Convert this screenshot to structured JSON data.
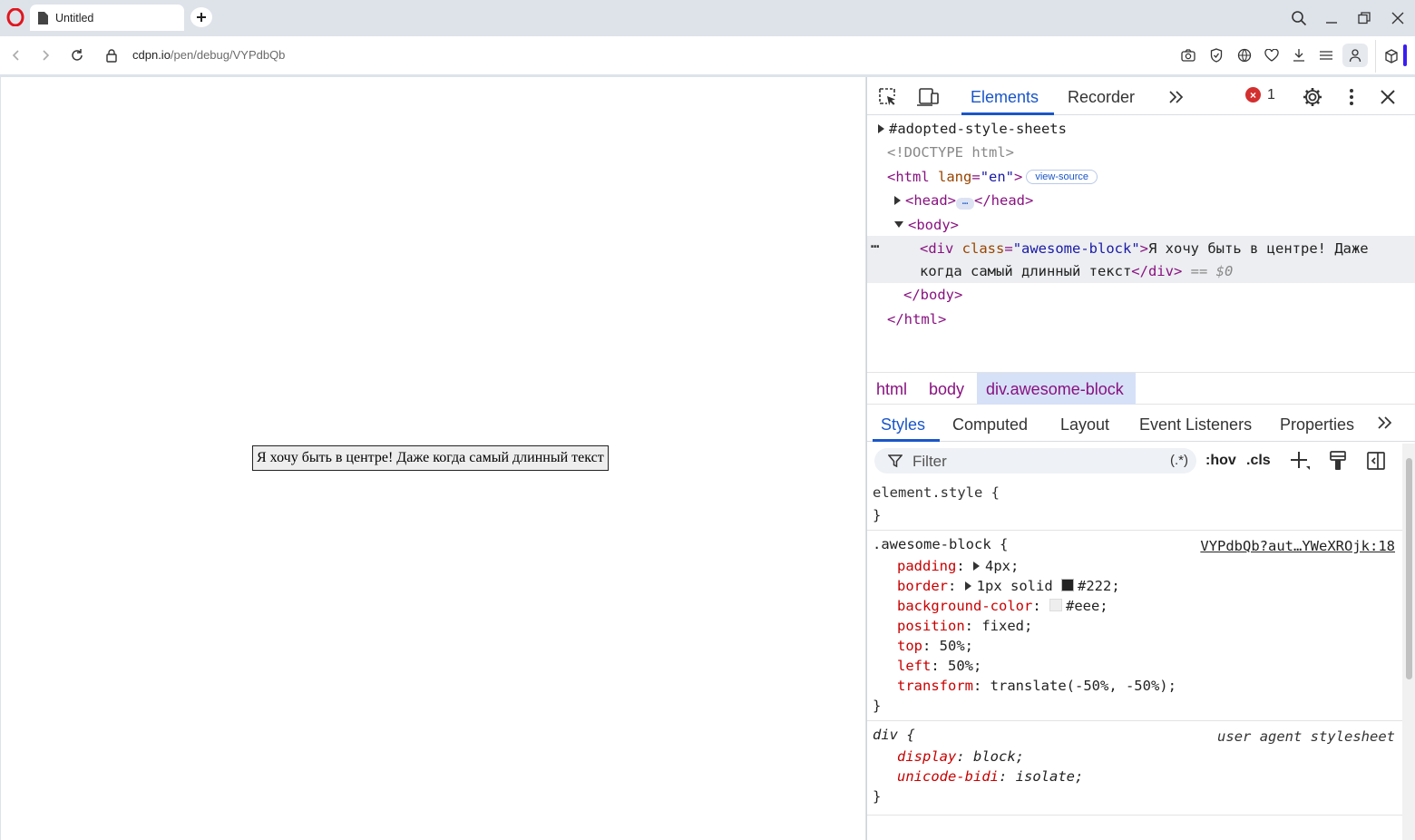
{
  "browser": {
    "tab_title": "Untitled",
    "url_host": "cdpn.io",
    "url_path": "/pen/debug/VYPdbQb"
  },
  "page": {
    "block_text": "Я хочу быть в центре! Даже когда самый длинный текст"
  },
  "devtools": {
    "tabs": [
      "Elements",
      "Recorder"
    ],
    "active_tab": "Elements",
    "error_count": "1",
    "dom": {
      "adopted": "#adopted-style-sheets",
      "doctype": "<!DOCTYPE html>",
      "html_open_tag": "<html",
      "html_attr": "lang",
      "html_attr_val": "\"en\"",
      "view_source": "view-source",
      "head_open": "<head>",
      "head_close": "</head>",
      "body_open": "<body>",
      "div_open": "<div",
      "div_attr": "class",
      "div_attr_val": "\"awesome-block\"",
      "div_text_1": "Я хочу быть в центре! Даже",
      "div_text_2": "когда самый длинный текст",
      "div_close": "</div>",
      "selected_marker": "== $0",
      "body_close": "</body>",
      "html_close": "</html>"
    },
    "breadcrumbs": [
      "html",
      "body",
      "div.awesome-block"
    ],
    "subtabs": [
      "Styles",
      "Computed",
      "Layout",
      "Event Listeners",
      "Properties"
    ],
    "active_subtab": "Styles",
    "filter": {
      "placeholder": "Filter",
      "regex": "(.*)",
      "hov": ":hov",
      "cls": ".cls"
    },
    "styles": {
      "element_style_open": "element.style {",
      "close_brace": "}",
      "awesome_selector": ".awesome-block {",
      "awesome_source": "VYPdbQb?aut…YWeXROjk:18",
      "awesome_props": [
        {
          "name": "padding",
          "value": "4px;"
        },
        {
          "name": "border",
          "value": "1px solid",
          "color_value": "#222;"
        },
        {
          "name": "background-color",
          "value": "#eee;"
        },
        {
          "name": "position",
          "value": "fixed;"
        },
        {
          "name": "top",
          "value": "50%;"
        },
        {
          "name": "left",
          "value": "50%;"
        },
        {
          "name": "transform",
          "value": "translate(-50%, -50%);"
        }
      ],
      "ua_selector": "div {",
      "ua_source": "user agent stylesheet",
      "ua_props": [
        {
          "name": "display",
          "value": "block;"
        },
        {
          "name": "unicode-bidi",
          "value": "isolate;"
        }
      ]
    }
  },
  "colors": {
    "accent": "#1a56c9",
    "tag": "#881280",
    "prop": "#c80000",
    "error": "#d32f2f"
  }
}
